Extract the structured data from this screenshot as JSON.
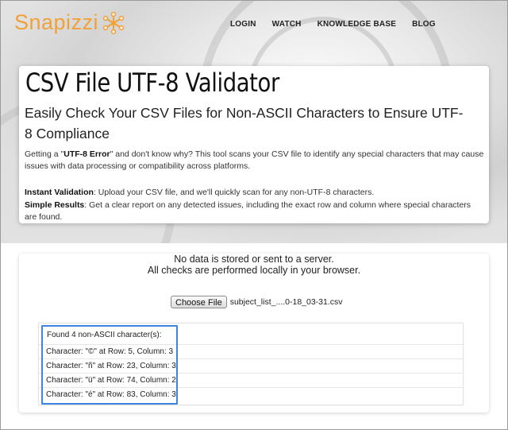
{
  "header": {
    "logo_text": "Snapizzi",
    "nav": [
      "LOGIN",
      "WATCH",
      "KNOWLEDGE BASE",
      "BLOG"
    ]
  },
  "hero": {
    "title": "CSV File UTF-8 Validator",
    "subtitle": "Easily Check Your CSV Files for Non-ASCII Characters to Ensure UTF-8 Compliance",
    "intro_prefix": "Getting a \"",
    "intro_bold": "UTF-8 Error",
    "intro_suffix": "\" and don't know why? This tool scans your CSV file to identify any special characters that may cause issues with data processing or compatibility across platforms.",
    "feature1_label": "Instant Validation",
    "feature1_text": ": Upload your CSV file, and we'll quickly scan for any non-UTF-8 characters.",
    "feature2_label": "Simple Results",
    "feature2_text": ": Get a clear report on any detected issues, including the exact row and column where special characters are found."
  },
  "tool": {
    "notice_line1": "No data is stored or sent to a server.",
    "notice_line2": "All checks are performed locally in your browser.",
    "choose_label": "Choose File",
    "file_name": "subject_list_....0-18_03-31.csv",
    "found_text": "Found 4 non-ASCII character(s):",
    "results": [
      "Character: \"©\" at Row: 5, Column: 3",
      "Character: \"ñ\" at Row: 23, Column: 3",
      "Character: \"ü\" at Row: 74, Column: 2",
      "Character: \"é\" at Row: 83, Column: 3"
    ]
  },
  "colors": {
    "logo": "#f0a13a",
    "highlight": "#3d86e0"
  }
}
